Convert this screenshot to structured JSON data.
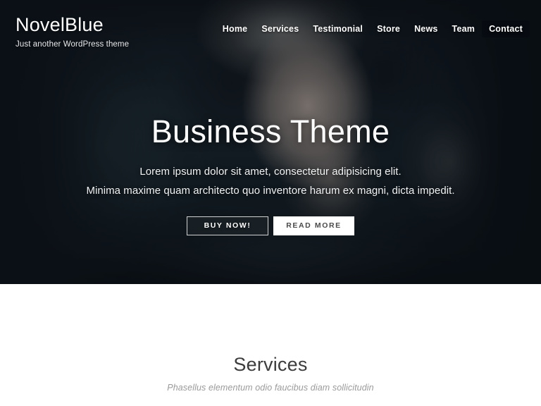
{
  "site": {
    "brand": "NovelBlue",
    "tagline": "Just another WordPress theme"
  },
  "nav": {
    "items": [
      {
        "label": "Home",
        "active": false
      },
      {
        "label": "Services",
        "active": false
      },
      {
        "label": "Testimonial",
        "active": false
      },
      {
        "label": "Store",
        "active": false
      },
      {
        "label": "News",
        "active": false
      },
      {
        "label": "Team",
        "active": false
      },
      {
        "label": "Contact",
        "active": true
      }
    ]
  },
  "hero": {
    "title": "Business Theme",
    "subtitle_line1": "Lorem ipsum dolor sit amet, consectetur adipisicing elit.",
    "subtitle_line2": "Minima maxime quam architecto quo inventore harum ex magni, dicta impedit.",
    "primary_button": "BUY NOW!",
    "secondary_button": "READ MORE",
    "background_image": "woman-in-fur-hooded-coat-photo"
  },
  "services": {
    "title": "Services",
    "subtitle": "Phasellus elementum odio faucibus diam sollicitudin"
  },
  "colors": {
    "hero_dark": "#0d1218",
    "text_light": "#ffffff",
    "button_solid_bg": "#ffffff",
    "button_solid_text": "#4a4a4a",
    "section_bg": "#ffffff",
    "section_title": "#3c3c3c",
    "section_subtitle": "#9a9a9a"
  }
}
